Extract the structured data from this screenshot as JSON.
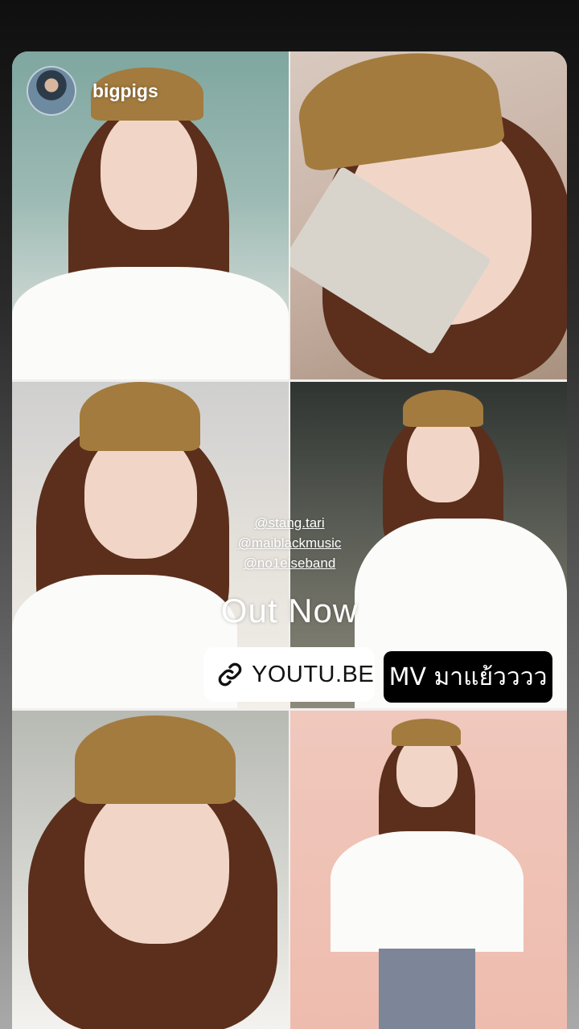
{
  "header": {
    "username": "bigpigs"
  },
  "mentions": [
    "@stang.tari",
    "@maiblackmusic",
    "@no1elseband"
  ],
  "headline": "Out Now",
  "link_sticker": {
    "label": "YOUTU.BE",
    "icon": "link-icon"
  },
  "mv_label": "MV มาแย้วววว",
  "colors": {
    "sticker_bg": "#ffffff",
    "label_bg": "#000000",
    "text_light": "#ffffff"
  }
}
